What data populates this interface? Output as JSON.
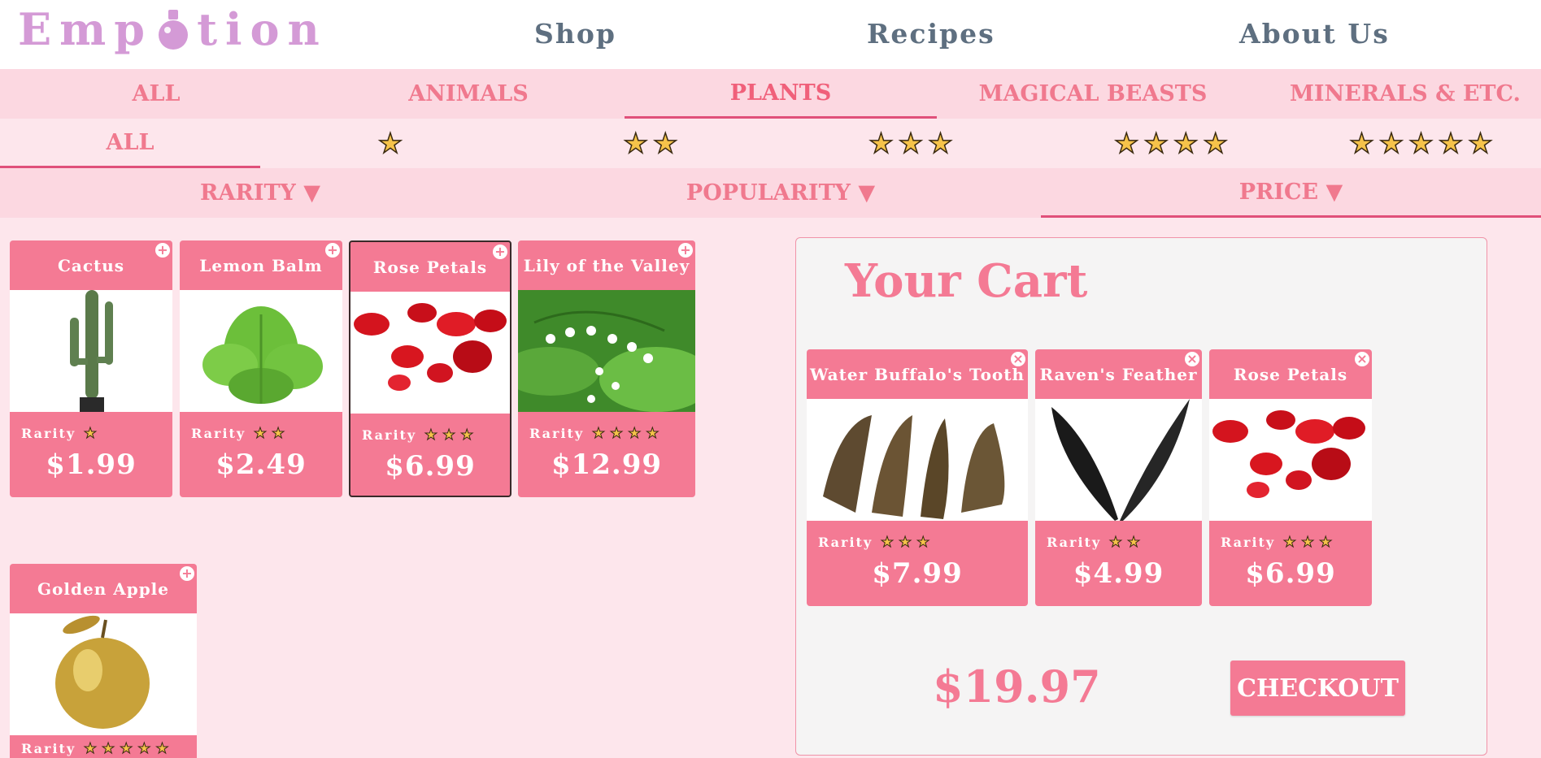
{
  "brand": {
    "name_left": "Emp",
    "name_right": "tion",
    "logo_color": "#d49ad6"
  },
  "nav": {
    "shop": "Shop",
    "recipes": "Recipes",
    "about": "About Us"
  },
  "categories": [
    "ALL",
    "ANIMALS",
    "PLANTS",
    "MAGICAL BEASTS",
    "MINERALS & ETC."
  ],
  "active_category": "PLANTS",
  "rarity_filters": {
    "all_label": "ALL",
    "levels": [
      1,
      2,
      3,
      4,
      5
    ],
    "active": "ALL"
  },
  "sort": [
    "RARITY ▼",
    "POPULARITY ▼",
    "PRICE ▼"
  ],
  "active_sort": "PRICE ▼",
  "products": [
    {
      "name": "Cactus",
      "rarity_label": "Rarity",
      "rarity": 1,
      "price": "$1.99",
      "image": "cactus"
    },
    {
      "name": "Lemon Balm",
      "rarity_label": "Rarity",
      "rarity": 2,
      "price": "$2.49",
      "image": "lemon-balm"
    },
    {
      "name": "Rose Petals",
      "rarity_label": "Rarity",
      "rarity": 3,
      "price": "$6.99",
      "image": "rose-petals"
    },
    {
      "name": "Lily of the Valley",
      "rarity_label": "Rarity",
      "rarity": 4,
      "price": "$12.99",
      "image": "lily-of-the-valley"
    },
    {
      "name": "Golden Apple",
      "rarity_label": "Rarity",
      "rarity": 5,
      "price": "",
      "image": "golden-apple"
    }
  ],
  "cart": {
    "title": "Your Cart",
    "items": [
      {
        "name": "Water Buffalo's Tooth",
        "rarity_label": "Rarity",
        "rarity": 3,
        "price": "$7.99",
        "image": "buffalo-tooth"
      },
      {
        "name": "Raven's Feather",
        "rarity_label": "Rarity",
        "rarity": 2,
        "price": "$4.99",
        "image": "raven-feather"
      },
      {
        "name": "Rose Petals",
        "rarity_label": "Rarity",
        "rarity": 3,
        "price": "$6.99",
        "image": "rose-petals"
      }
    ],
    "total": "$19.97",
    "checkout_label": "CHECKOUT"
  },
  "icons": {
    "add": "plus-icon",
    "remove": "close-icon",
    "star": "star-icon"
  },
  "colors": {
    "accent": "#f47a94",
    "background": "#fde6ec",
    "nav_text": "#5e6f80",
    "star": "#f6c34a"
  }
}
